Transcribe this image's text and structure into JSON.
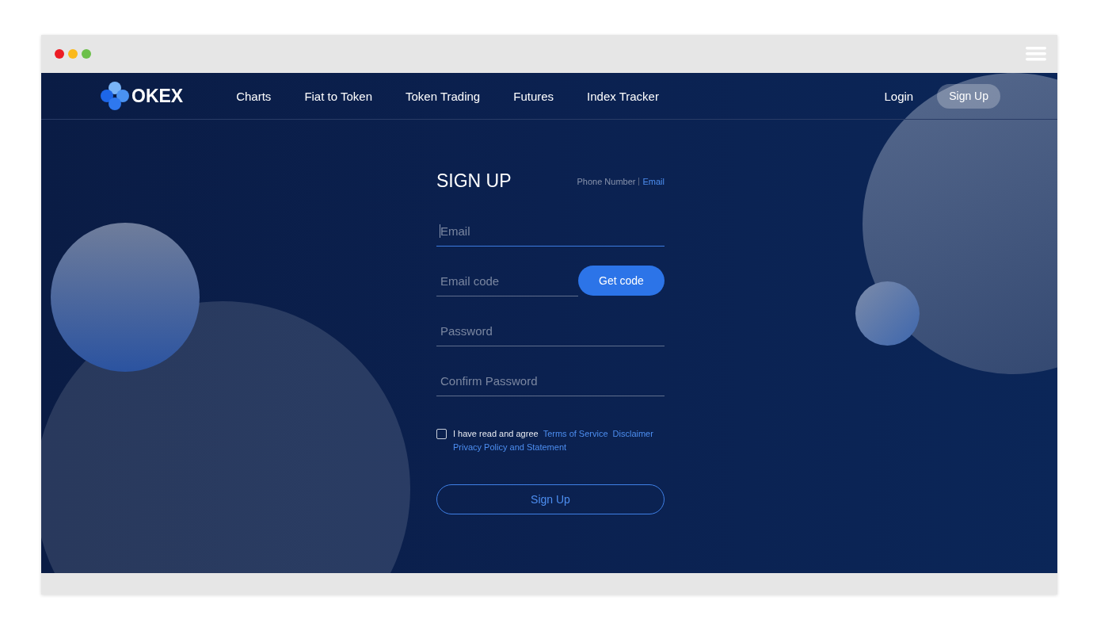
{
  "logo": {
    "text": "OKEX"
  },
  "nav": [
    {
      "label": "Charts"
    },
    {
      "label": "Fiat to Token"
    },
    {
      "label": "Token Trading"
    },
    {
      "label": "Futures"
    },
    {
      "label": "Index Tracker"
    }
  ],
  "auth": {
    "login": "Login",
    "signup": "Sign Up"
  },
  "form": {
    "title": "SIGN UP",
    "modes": [
      {
        "label": "Phone Number",
        "selected": false
      },
      {
        "label": "Email",
        "selected": true
      }
    ],
    "fields": [
      {
        "kind": "text",
        "placeholder": "Email",
        "focused": true
      },
      {
        "kind": "code",
        "placeholder": "Email code",
        "focused": false,
        "button": "Get code"
      },
      {
        "kind": "text",
        "placeholder": "Password",
        "focused": false
      },
      {
        "kind": "text",
        "placeholder": "Confirm Password",
        "focused": false
      }
    ],
    "agreement": {
      "checked": false,
      "text": "I have read and agree",
      "links": [
        "Terms of Service",
        "Disclaimer",
        "Privacy Policy and Statement"
      ]
    },
    "submit": "Sign Up"
  }
}
